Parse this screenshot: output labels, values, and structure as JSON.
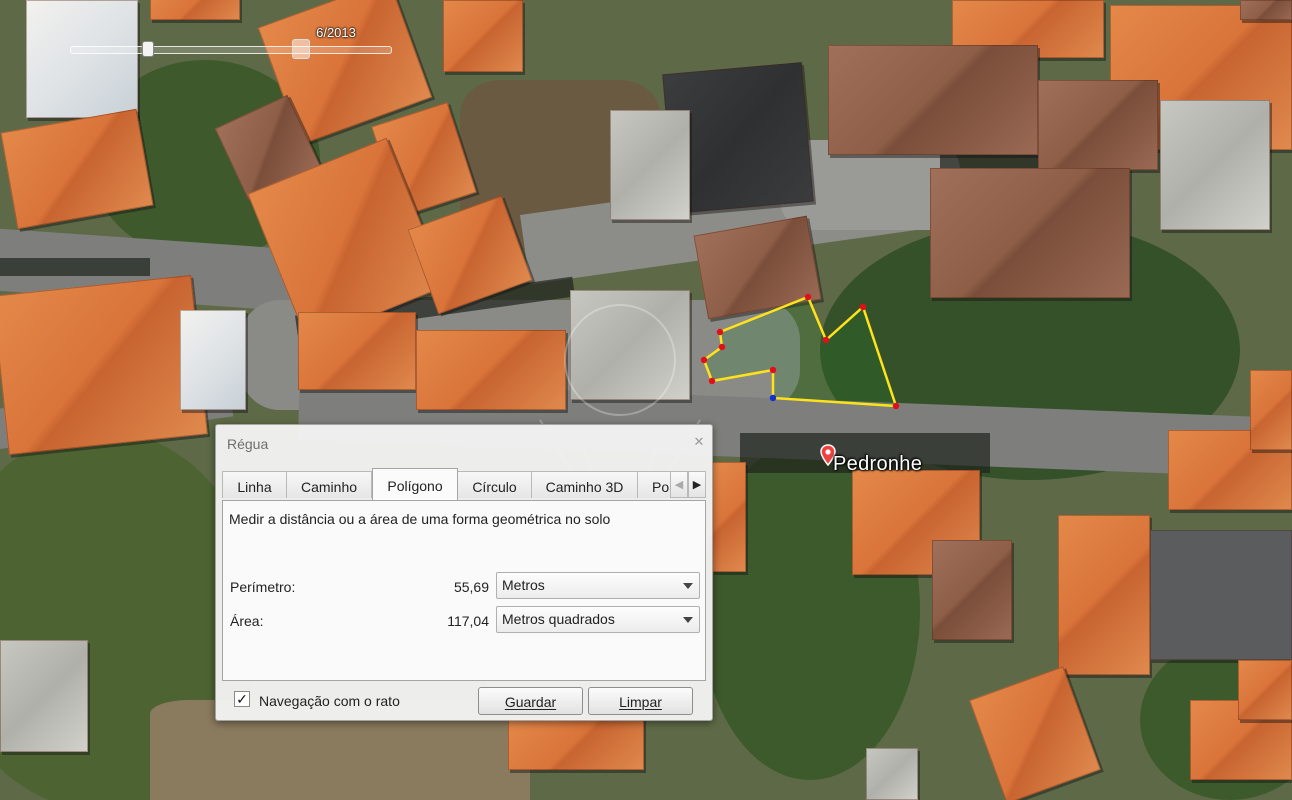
{
  "map": {
    "time_slider": {
      "date_label": "6/2013"
    },
    "place": {
      "name": "Pedronhe",
      "icon": "map-pin-icon"
    },
    "measurement_polygon": {
      "stroke_color": "#ffe21a",
      "vertex_color": "#e0101a",
      "active_vertex_color": "#1030d0"
    }
  },
  "ruler": {
    "title": "Régua",
    "close_icon": "close-icon",
    "tabs": [
      {
        "label": "Linha"
      },
      {
        "label": "Caminho"
      },
      {
        "label": "Polígono",
        "active": true
      },
      {
        "label": "Círculo"
      },
      {
        "label": "Caminho 3D"
      },
      {
        "label": "Po"
      }
    ],
    "description": "Medir a distância ou a área de uma forma geométrica no solo",
    "perimeter": {
      "label": "Perímetro:",
      "value": "55,69",
      "unit": "Metros"
    },
    "area": {
      "label": "Área:",
      "value": "117,04",
      "unit": "Metros quadrados"
    },
    "mouse_nav": {
      "label": "Navegação com o rato",
      "checked": true,
      "check_mark": "✓"
    },
    "save_label": "Guardar",
    "clear_label": "Limpar"
  }
}
